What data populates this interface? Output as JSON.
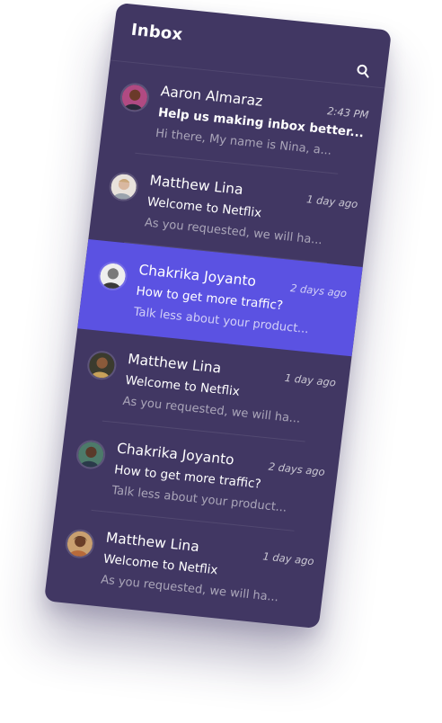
{
  "header": {
    "title": "Inbox"
  },
  "icons": {
    "search": "search-icon"
  },
  "colors": {
    "panel_bg": "#413763",
    "selected_bg": "#5b52e2",
    "text": "#ffffff"
  },
  "messages": [
    {
      "sender": "Aaron Almaraz",
      "time": "2:43 PM",
      "subject": "Help us making inbox better...",
      "preview": "Hi there, My name is Nina, a...",
      "selected": false,
      "unread": true
    },
    {
      "sender": "Matthew Lina",
      "time": "1 day ago",
      "subject": "Welcome to Netflix",
      "preview": "As you requested, we will ha...",
      "selected": false,
      "unread": false
    },
    {
      "sender": "Chakrika Joyanto",
      "time": "2 days ago",
      "subject": "How to get more traffic?",
      "preview": "Talk less about your product...",
      "selected": true,
      "unread": false
    },
    {
      "sender": "Matthew Lina",
      "time": "1 day ago",
      "subject": "Welcome to Netflix",
      "preview": "As you requested, we will ha...",
      "selected": false,
      "unread": false
    },
    {
      "sender": "Chakrika Joyanto",
      "time": "2 days ago",
      "subject": "How to get more traffic?",
      "preview": "Talk less about your product...",
      "selected": false,
      "unread": false
    },
    {
      "sender": "Matthew Lina",
      "time": "1 day ago",
      "subject": "Welcome to Netflix",
      "preview": "As you requested, we will ha...",
      "selected": false,
      "unread": false
    }
  ]
}
